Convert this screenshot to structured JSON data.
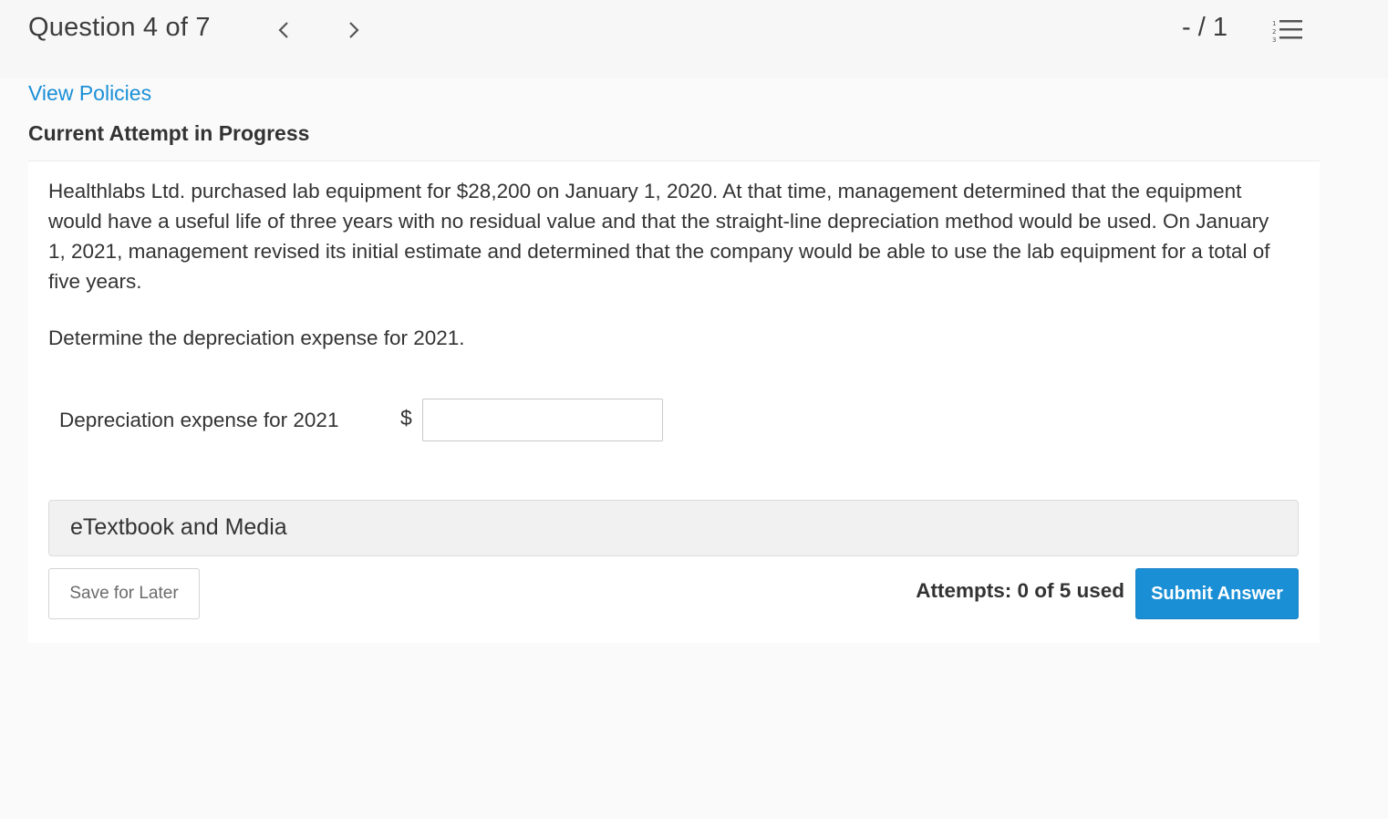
{
  "header": {
    "question_label": "Question 4 of 7",
    "score": "- / 1",
    "prev_icon": "chevron-left-icon",
    "next_icon": "chevron-right-icon",
    "list_icon": "numbered-list-icon"
  },
  "policies_link": "View Policies",
  "attempt_heading": "Current Attempt in Progress",
  "question": {
    "text": "Healthlabs Ltd. purchased lab equipment for $28,200 on January 1, 2020. At that time, management determined that the equipment would have a useful life of three years with no residual value and that the straight-line depreciation method would be used. On January 1, 2021, management revised its initial estimate and determined that the company would be able to use the lab equipment for a total of five years.",
    "prompt": "Determine the depreciation expense for 2021."
  },
  "answer": {
    "label": "Depreciation expense for 2021",
    "currency": "$",
    "value": ""
  },
  "etextbook_label": "eTextbook and Media",
  "footer": {
    "save_label": "Save for Later",
    "attempts_text": "Attempts: 0 of 5 used",
    "submit_label": "Submit Answer"
  },
  "colors": {
    "accent": "#1a8fd6",
    "page_bg": "#fafafa",
    "etextbook_bg": "#f1f1f1"
  }
}
